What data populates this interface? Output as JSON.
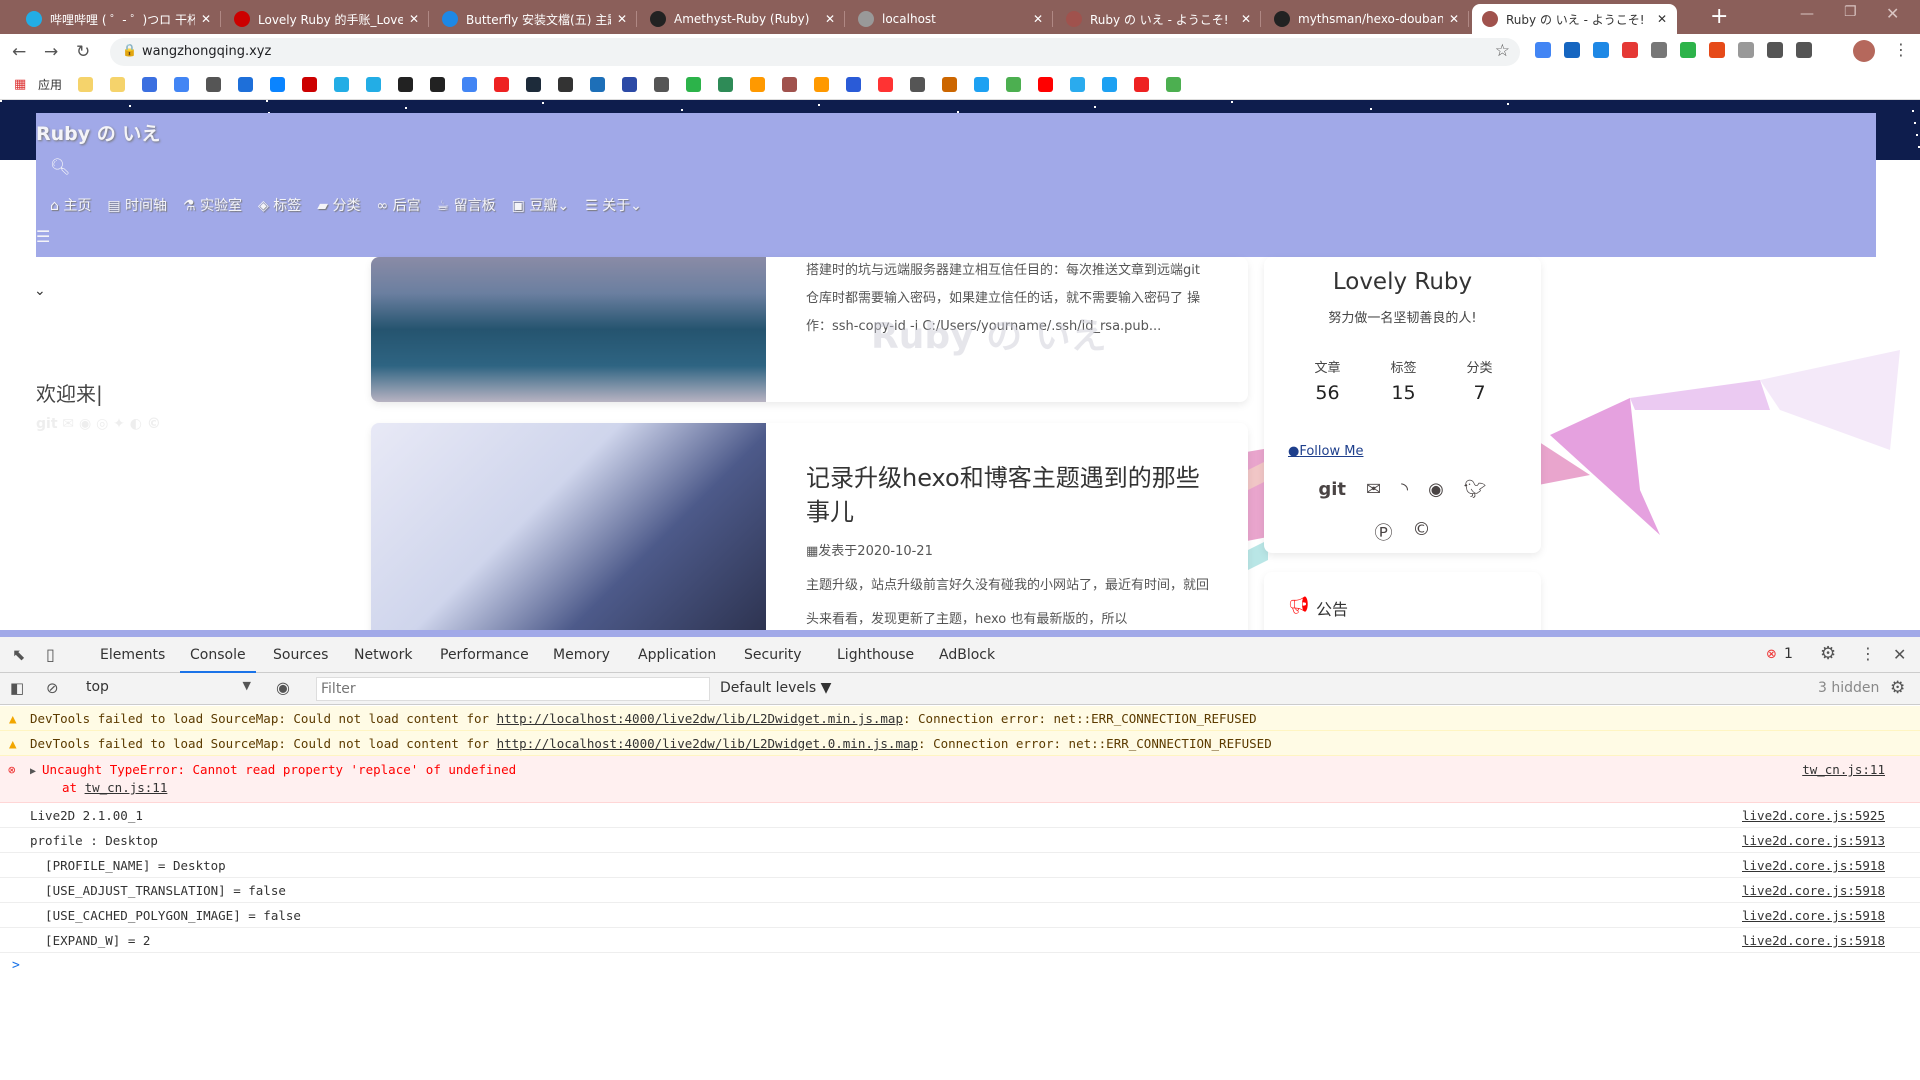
{
  "browser": {
    "tabs": [
      {
        "title": "哔哩哔哩 ( ゜- ゜)つロ 干杯~",
        "icon": "bilibili-icon",
        "color": "#23ade5"
      },
      {
        "title": "Lovely Ruby 的手账_Lovely",
        "icon": "csdn-icon",
        "color": "#c00"
      },
      {
        "title": "Butterfly 安装文檔(五) 主題",
        "icon": "butterfly-icon",
        "color": "#1e88e5"
      },
      {
        "title": "Amethyst-Ruby (Ruby)",
        "icon": "github-icon",
        "color": "#222"
      },
      {
        "title": "localhost",
        "icon": "globe-icon",
        "color": "#999"
      },
      {
        "title": "Ruby の いえ - ようこそ!",
        "icon": "avatar-icon",
        "color": "#a0524d"
      },
      {
        "title": "mythsman/hexo-douban: A",
        "icon": "github-icon",
        "color": "#222"
      },
      {
        "title": "Ruby の いえ - ようこそ!",
        "icon": "avatar-icon",
        "color": "#a0524d"
      }
    ],
    "url": "wangzhongqing.xyz",
    "apps_label": "应用"
  },
  "site": {
    "title": "Ruby の いえ",
    "nav": [
      {
        "icon": "home-icon",
        "glyph": "⌂",
        "label": "主页"
      },
      {
        "icon": "archive-icon",
        "glyph": "▤",
        "label": "时间轴"
      },
      {
        "icon": "flask-icon",
        "glyph": "⚗",
        "label": "实验室"
      },
      {
        "icon": "tags-icon",
        "glyph": "◈",
        "label": "标签"
      },
      {
        "icon": "folder-icon",
        "glyph": "▰",
        "label": "分类"
      },
      {
        "icon": "link-icon",
        "glyph": "∞",
        "label": "后宫"
      },
      {
        "icon": "coffee-icon",
        "glyph": "☕",
        "label": "留言板"
      },
      {
        "icon": "gift-icon",
        "glyph": "▣",
        "label": "豆瓣",
        "caret": "⌄"
      },
      {
        "icon": "list-icon",
        "glyph": "☰",
        "label": "关于",
        "caret": "⌄"
      }
    ],
    "welcome": "欢迎来|",
    "posts": [
      {
        "excerpt": "搭建时的坑与远端服务器建立相互信任目的：每次推送文章到远端git仓库时都需要输入密码，如果建立信任的话，就不需要输入密码了 操作：ssh-copy-id -i C:/Users/yourname/.ssh/id_rsa.pub..."
      },
      {
        "title": "记录升级hexo和博客主题遇到的那些事儿",
        "date": "发表于2020-10-21",
        "excerpt": "主题升级，站点升级前言好久没有碰我的小网站了，最近有时间，就回头来看看，发现更新了主题，hexo 也有最新版的，所以"
      }
    ],
    "watermark": "Ruby の いえ",
    "profile": {
      "name": "Lovely Ruby",
      "motto": "努力做一名坚韧善良的人!",
      "stats": [
        {
          "label": "文章",
          "value": "56"
        },
        {
          "label": "标签",
          "value": "15"
        },
        {
          "label": "分类",
          "value": "7"
        }
      ],
      "follow": "Follow Me",
      "git": "git"
    },
    "notice": "公告"
  },
  "devtools": {
    "tabs": [
      "Elements",
      "Console",
      "Sources",
      "Network",
      "Performance",
      "Memory",
      "Application",
      "Security",
      "Lighthouse",
      "AdBlock"
    ],
    "active_tab": "Console",
    "error_count": "1",
    "context": "top",
    "filter_placeholder": "Filter",
    "levels": "Default levels ▼",
    "hidden": "3 hidden",
    "messages": [
      {
        "type": "warning",
        "pre": "DevTools failed to load SourceMap: Could not load content for ",
        "link": "http://localhost:4000/live2dw/lib/L2Dwidget.min.js.map",
        "post": ": Connection error: net::ERR_CONNECTION_REFUSED"
      },
      {
        "type": "warning",
        "pre": "DevTools failed to load SourceMap: Could not load content for ",
        "link": "http://localhost:4000/live2dw/lib/L2Dwidget.0.min.js.map",
        "post": ": Connection error: net::ERR_CONNECTION_REFUSED"
      },
      {
        "type": "error",
        "text": "Uncaught TypeError: Cannot read property 'replace' of undefined",
        "at": "at ",
        "atlink": "tw_cn.js:11",
        "src": "tw_cn.js:11"
      },
      {
        "type": "log",
        "text": "Live2D 2.1.00_1",
        "src": "live2d.core.js:5925"
      },
      {
        "type": "log",
        "text": "profile : Desktop",
        "src": "live2d.core.js:5913"
      },
      {
        "type": "log",
        "text": "  [PROFILE_NAME] = Desktop",
        "src": "live2d.core.js:5918"
      },
      {
        "type": "log",
        "text": "  [USE_ADJUST_TRANSLATION] = false",
        "src": "live2d.core.js:5918"
      },
      {
        "type": "log",
        "text": "  [USE_CACHED_POLYGON_IMAGE] = false",
        "src": "live2d.core.js:5918"
      },
      {
        "type": "log",
        "text": "  [EXPAND_W] = 2",
        "src": "live2d.core.js:5918"
      }
    ],
    "prompt": ">"
  },
  "colors": {
    "tabbar": "#8b5f5a",
    "header": "#a1a9e8",
    "accent": "#1a73e8",
    "error": "#f00"
  }
}
